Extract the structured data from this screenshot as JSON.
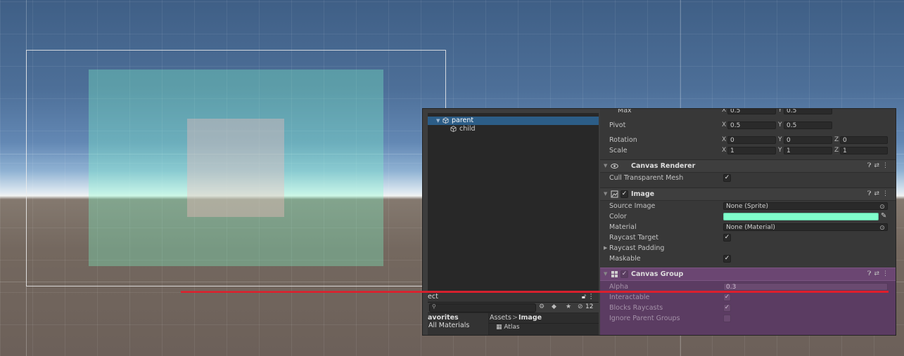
{
  "colors": {
    "image_color": "#80FFCC",
    "annotation_red": "#E01E2C",
    "canvas_group_highlight": "#6b4672",
    "selection": "#2c5d87"
  },
  "hierarchy": {
    "items": [
      {
        "label": "parent",
        "selected": true,
        "icon": "cube-icon"
      },
      {
        "label": "child",
        "selected": false,
        "icon": "cube-icon"
      }
    ]
  },
  "project": {
    "tab_label": "ect",
    "hidden_count": "12",
    "favorites_label": "avorites",
    "all_materials_label": "All Materials",
    "breadcrumb_root": "Assets",
    "breadcrumb_sep": ">",
    "breadcrumb_current": "Image",
    "asset_item": "Atlas"
  },
  "inspector": {
    "rect": {
      "max_label": "Max",
      "max_x": "0.5",
      "max_y": "0.5",
      "pivot_label": "Pivot",
      "pivot_x": "0.5",
      "pivot_y": "0.5",
      "rotation_label": "Rotation",
      "rotation_x": "0",
      "rotation_y": "0",
      "rotation_z": "0",
      "scale_label": "Scale",
      "scale_x": "1",
      "scale_y": "1",
      "scale_z": "1",
      "axis_x": "X",
      "axis_y": "Y",
      "axis_z": "Z"
    },
    "canvas_renderer": {
      "title": "Canvas Renderer",
      "cull_label": "Cull Transparent Mesh",
      "cull_checked": true
    },
    "image": {
      "title": "Image",
      "source_image_label": "Source Image",
      "source_image_value": "None (Sprite)",
      "color_label": "Color",
      "material_label": "Material",
      "material_value": "None (Material)",
      "raycast_target_label": "Raycast Target",
      "raycast_padding_label": "Raycast Padding",
      "maskable_label": "Maskable"
    },
    "canvas_group": {
      "title": "Canvas Group",
      "alpha_label": "Alpha",
      "alpha_value": "0.3",
      "interactable_label": "Interactable",
      "blocks_raycasts_label": "Blocks Raycasts",
      "ignore_parent_groups_label": "Ignore Parent Groups"
    }
  }
}
